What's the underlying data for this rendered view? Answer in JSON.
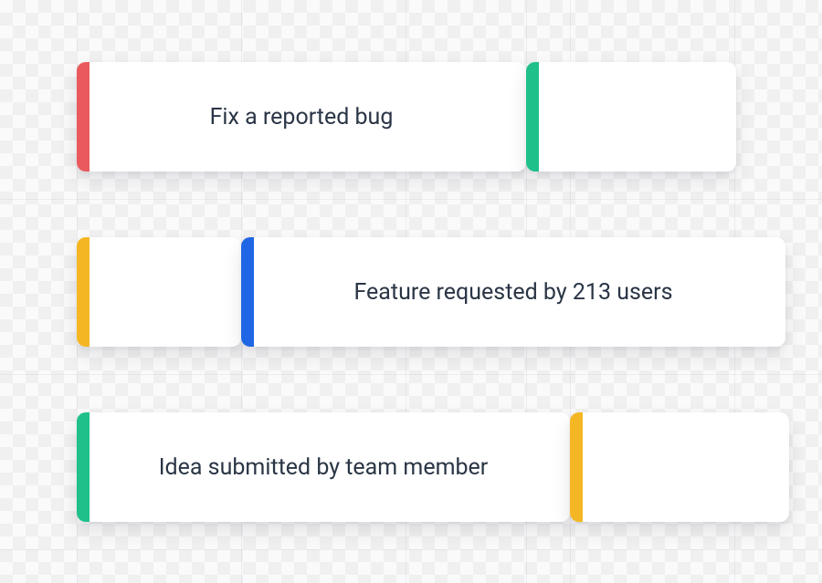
{
  "lanes": [
    {
      "cards": [
        {
          "id": "bug",
          "label": "Fix a reported bug",
          "color": "red"
        },
        {
          "id": "bug-followup",
          "label": "",
          "color": "green"
        }
      ]
    },
    {
      "cards": [
        {
          "id": "feature-prep",
          "label": "",
          "color": "yellow"
        },
        {
          "id": "feature",
          "label": "Feature requested by 213 users",
          "color": "blue"
        }
      ]
    },
    {
      "cards": [
        {
          "id": "idea",
          "label": "Idea submitted by team member",
          "color": "green"
        },
        {
          "id": "idea-followup",
          "label": "",
          "color": "yellow"
        }
      ]
    }
  ],
  "colors": {
    "red": "#ea5a5d",
    "green": "#1fc08a",
    "yellow": "#f4b723",
    "blue": "#1f66e5"
  }
}
